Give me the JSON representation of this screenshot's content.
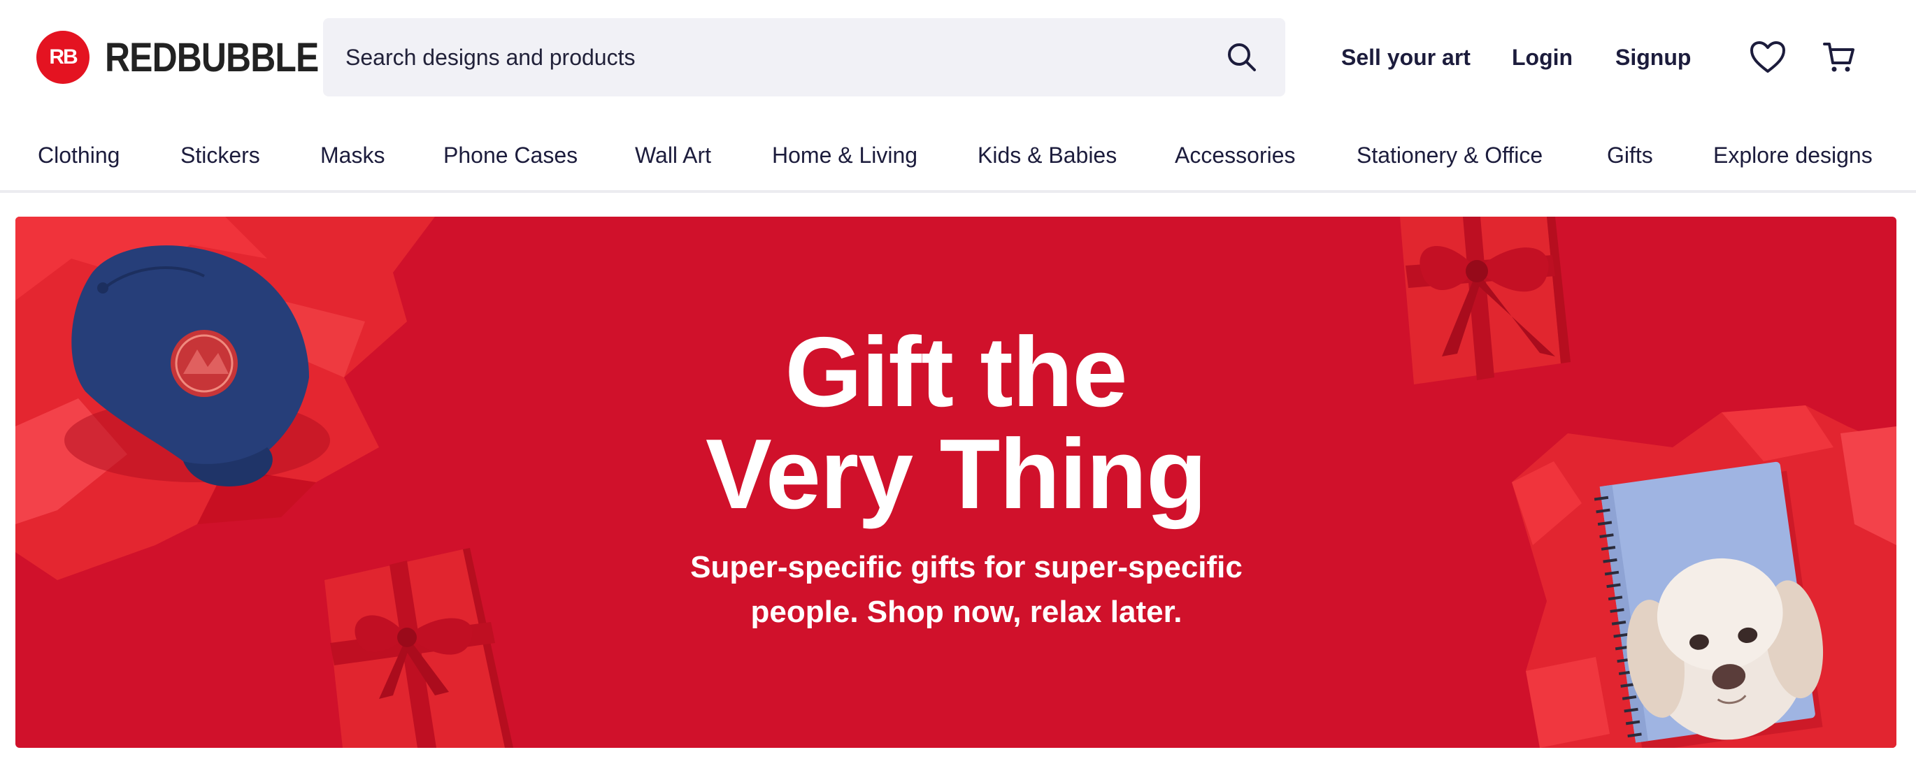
{
  "brand": {
    "logo_mark": "RB",
    "name": "REDBUBBLE",
    "color": "#e41321"
  },
  "search": {
    "placeholder": "Search designs and products",
    "icon": "search-icon"
  },
  "header_links": {
    "sell": "Sell your art",
    "login": "Login",
    "signup": "Signup"
  },
  "header_icons": {
    "wishlist": "heart-icon",
    "cart": "cart-icon"
  },
  "categories": [
    "Clothing",
    "Stickers",
    "Masks",
    "Phone Cases",
    "Wall Art",
    "Home & Living",
    "Kids & Babies",
    "Accessories",
    "Stationery & Office",
    "Gifts",
    "Explore designs"
  ],
  "hero": {
    "title_line1": "Gift the",
    "title_line2": "Very Thing",
    "subtitle_line1": "Super-specific gifts for super-specific",
    "subtitle_line2": "people. Shop now, relax later.",
    "background": "#d0112b"
  },
  "colors": {
    "text": "#1c1c3c",
    "search_bg": "#f1f1f6",
    "accent": "#e41321"
  }
}
